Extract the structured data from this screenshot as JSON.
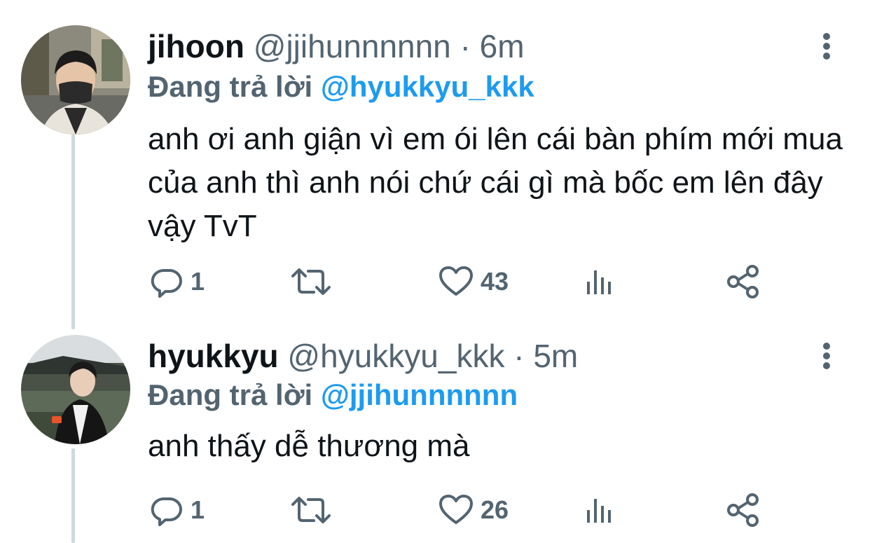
{
  "tweets": [
    {
      "display_name": "jihoon",
      "handle": "@jjihunnnnnn",
      "separator": "·",
      "time": "6m",
      "replying_label": "Đang trả lời",
      "replying_to": "@hyukkyu_kkk",
      "text": "anh ơi anh giận vì em ói lên cái bàn phím mới mua của anh thì anh nói chứ cái gì mà bốc em lên đây vậy TvT",
      "reply_count": "1",
      "like_count": "43"
    },
    {
      "display_name": "hyukkyu",
      "handle": "@hyukkyu_kkk",
      "separator": "·",
      "time": "5m",
      "replying_label": "Đang trả lời",
      "replying_to": "@jjihunnnnnn",
      "text": "anh thấy dễ thương mà",
      "reply_count": "1",
      "like_count": "26"
    }
  ],
  "colors": {
    "text": "#0f1419",
    "secondary": "#536471",
    "accent": "#1d9bf0",
    "thread_line": "#cfd9de"
  },
  "icons": [
    "reply-icon",
    "retweet-icon",
    "like-icon",
    "analytics-icon",
    "share-icon",
    "more-icon"
  ]
}
